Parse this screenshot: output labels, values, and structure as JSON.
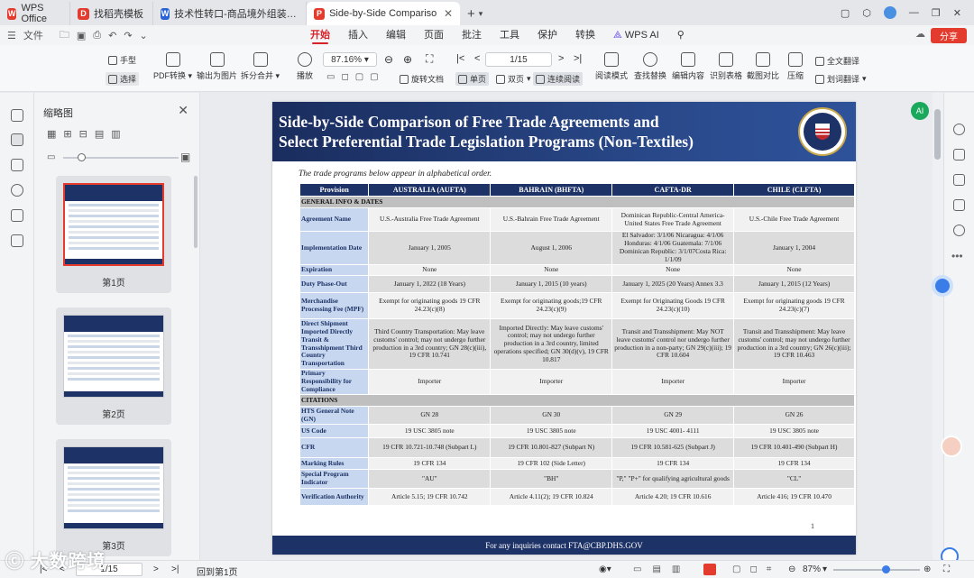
{
  "tabs": [
    {
      "label": "WPS Office",
      "color": "#e33b2d",
      "glyph": "W"
    },
    {
      "label": "找稻壳模板",
      "color": "#e33b2d",
      "glyph": "D"
    },
    {
      "label": "技术性转口-商品境外组装与生产的...",
      "color": "#2b62d6",
      "glyph": "W"
    },
    {
      "label": "Side-by-Side Comparison of Tr",
      "color": "#e33b2d",
      "glyph": "P"
    }
  ],
  "menu": {
    "file": "文件",
    "items": [
      "开始",
      "插入",
      "编辑",
      "页面",
      "批注",
      "工具",
      "保护",
      "转换"
    ],
    "wpsai": "WPS AI",
    "share": "分享"
  },
  "ribbon": {
    "hand": "手型",
    "select": "选择",
    "pdf_convert": "PDF转换",
    "to_image": "输出为图片",
    "split_merge": "拆分合并",
    "play": "播放",
    "zoom": "87.16%",
    "page_field": "1/15",
    "rotate": "旋转文档",
    "single": "单页",
    "double": "双页",
    "continuous": "连续阅读",
    "read_mode": "阅读模式",
    "find_replace": "查找替换",
    "edit_content": "编辑内容",
    "ocr": "识别表格",
    "screenshot_compare": "截图对比",
    "compress": "压缩",
    "full_translate": "全文翻译",
    "word_translate": "划词翻译"
  },
  "thumbs": {
    "title": "缩略图",
    "pages": [
      "第1页",
      "第2页",
      "第3页"
    ]
  },
  "doc": {
    "title_line1": "Side-by-Side Comparison of Free Trade Agreements and",
    "title_line2": "Select Preferential Trade Legislation Programs (Non-Textiles)",
    "intro": "The trade programs below appear in alphabetical order.",
    "columns": [
      "Provision",
      "AUSTRALIA (AUFTA)",
      "BAHRAIN (BHFTA)",
      "CAFTA-DR",
      "CHILE (CLFTA)"
    ],
    "rows": [
      {
        "section": "GENERAL INFO & DATES"
      },
      {
        "label": "Agreement Name",
        "h": 26,
        "cells": [
          "U.S.-Australia Free Trade Agreement",
          "U.S.-Bahrain Free Trade Agreement",
          "Dominican Republic-Central America-United States Free Trade Agreement",
          "U.S.-Chile Free Trade Agreement"
        ]
      },
      {
        "label": "Implementation Date",
        "h": 37,
        "cells": [
          "January 1, 2005",
          "August 1, 2006",
          "El Salvador: 3/1/06 Nicaragua: 4/1/06 Honduras: 4/1/06 Guatemala: 7/1/06 Dominican Republic: 3/1/07Costa Rica: 1/1/09",
          "January 1, 2004"
        ]
      },
      {
        "label": "Expiration",
        "h": 12,
        "cells": [
          "None",
          "None",
          "None",
          "None"
        ]
      },
      {
        "label": "Duty Phase-Out",
        "h": 19,
        "cells": [
          "January 1, 2022 (18 Years)",
          "January 1, 2015 (10 years)",
          "January 1, 2025 (20 Years) Annex 3.3",
          "January 1, 2015 (12 Years)"
        ]
      },
      {
        "label": "Merchandise Processing Fee (MPF)",
        "h": 29,
        "cells": [
          "Exempt for originating goods 19 CFR 24.23(c)(8)",
          "Exempt for originating goods;19 CFR 24.23(c)(9)",
          "Exempt for Originating Goods 19 CFR 24.23(c)(10)",
          "Exempt for originating goods 19 CFR 24.23(c)(7)"
        ]
      },
      {
        "label": "Direct Shipment Imported Directly Transit & Transshipment Third Country Transportation",
        "h": 56,
        "cells": [
          "Third Country Transportation: May leave customs' control; may not undergo further production in a 3rd country; GN 28(c)(iii), 19 CFR 10.741",
          "Imported Directly: May leave customs' control; may not undergo further production in a 3rd country, limited operations specified; GN 30(d)(v), 19 CFR 10.817",
          "Transit and Transshipment: May NOT leave customs' control nor undergo further production in a non-party; GN 29(c)(iii); 19 CFR 10.604",
          "Transit and Transshipment: May leave customs' control; may not undergo further production in a 3rd country; GN 26(c)(iii); 19 CFR 10.463"
        ]
      },
      {
        "label": "Primary Responsibility for Compliance",
        "h": 28,
        "cells": [
          "Importer",
          "Importer",
          "Importer",
          "Importer"
        ]
      },
      {
        "section": "CITATIONS"
      },
      {
        "label": "HTS General Note (GN)",
        "h": 20,
        "cells": [
          "GN 28",
          "GN 30",
          "GN 29",
          "GN 26"
        ]
      },
      {
        "label": "US Code",
        "h": 15,
        "cells": [
          "19 USC 3805 note",
          "19 USC 3805 note",
          "19 USC 4001- 4111",
          "19 USC 3805 note"
        ]
      },
      {
        "label": "CFR",
        "h": 22,
        "cells": [
          "19 CFR 10.721-10.748 (Subpart L)",
          "19 CFR 10.801-827 (Subpart N)",
          "19 CFR 10.581-625 (Subpart J)",
          "19 CFR 10.401-490 (Subpart H)"
        ]
      },
      {
        "label": "Marking Rules",
        "h": 13,
        "cells": [
          "19 CFR 134",
          "19 CFR 102 (Side Letter)",
          "19 CFR 134",
          "19 CFR 134"
        ]
      },
      {
        "label": "Special Program Indicator",
        "h": 21,
        "cells": [
          "\"AU\"",
          "\"BH\"",
          "\"P,\" \"P+\" for qualifying agricultural goods",
          "\"CL\""
        ]
      },
      {
        "label": "Verification Authority",
        "h": 19,
        "cells": [
          "Article 5.15; 19 CFR 10.742",
          "Article 4.11(2); 19 CFR 10.824",
          "Article 4.20; 19 CFR 10.616",
          "Article 416; 19 CFR 10.470"
        ]
      }
    ],
    "page_number": "1",
    "footer": "For any inquiries contact FTA@CBP.DHS.GOV"
  },
  "status": {
    "page": "1/15",
    "goto": "回到第1页",
    "zoom": "87%",
    "watermark": "大数跨境"
  }
}
